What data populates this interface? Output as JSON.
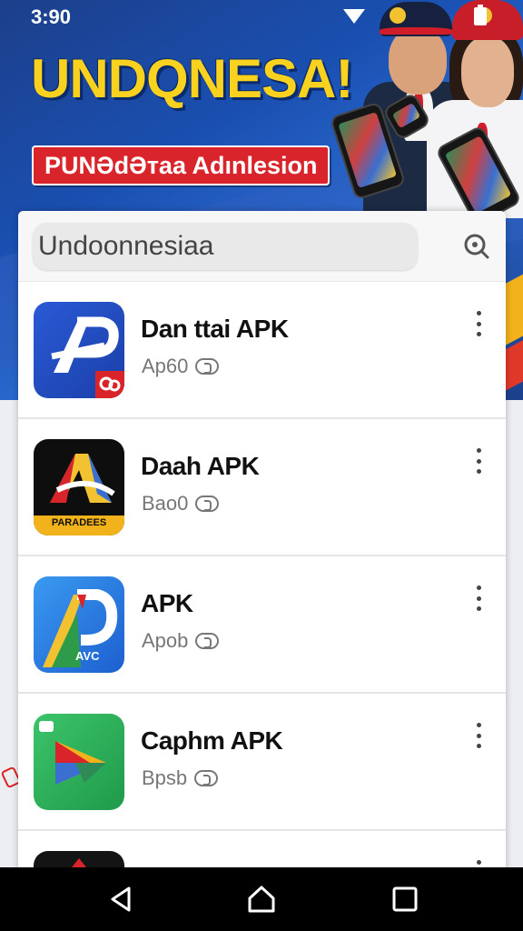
{
  "status_bar": {
    "time": "3:90"
  },
  "banner": {
    "headline": "UNDQNESA!",
    "tagline": "PUNƏdƏᴛaa Adınlesion"
  },
  "search": {
    "value": "Undoonnesiaa"
  },
  "apps": [
    {
      "name": "Dan ttai APK",
      "sub": "Ap60",
      "icon": "ap-app-icon"
    },
    {
      "name": "Daah APK",
      "sub": "Bao0",
      "icon": "triangle-app-icon",
      "icon_caption": "PARADEES"
    },
    {
      "name": "APK",
      "sub": "Apob",
      "icon": "p-app-icon",
      "icon_caption": "AVC"
    },
    {
      "name": "Caphm APK",
      "sub": "Bpsb",
      "icon": "play-app-icon"
    },
    {
      "name": "",
      "sub": "",
      "icon": "dark-app-icon"
    }
  ],
  "colors": {
    "banner_blue": "#1a4fb0",
    "headline_yellow": "#f8d21e",
    "tag_red": "#d8242a",
    "nav_black": "#000000"
  },
  "nav": {
    "back": "back-icon",
    "home": "home-icon",
    "recents": "recents-icon"
  }
}
